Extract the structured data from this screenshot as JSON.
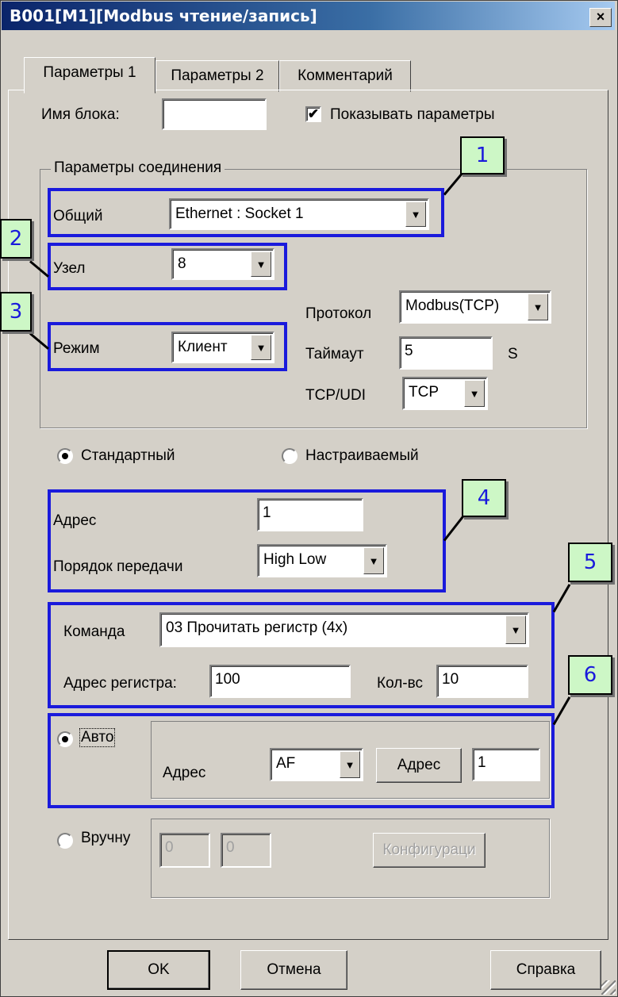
{
  "window": {
    "title": "B001[M1][Modbus чтение/запись]",
    "close_label": "×"
  },
  "tabs": [
    {
      "label": "Параметры 1",
      "active": true
    },
    {
      "label": "Параметры 2",
      "active": false
    },
    {
      "label": "Комментарий",
      "active": false
    }
  ],
  "block": {
    "name_label": "Имя блока:",
    "name_value": "",
    "show_params_label": "Показывать параметры",
    "show_params_checked": true,
    "check_glyph": "✔"
  },
  "connection": {
    "group_label": "Параметры соединения",
    "common_label": "Общий",
    "common_value": "Ethernet : Socket 1",
    "node_label": "Узел",
    "node_value": "8",
    "mode_label": "Режим",
    "mode_value": "Клиент",
    "protocol_label": "Протокол",
    "protocol_value": "Modbus(TCP)",
    "timeout_label": "Таймаут",
    "timeout_value": "5",
    "timeout_unit": "S",
    "tcpudp_label": "TCP/UDI",
    "tcpudp_value": "TCP"
  },
  "mode_radio": {
    "standard_label": "Стандартный",
    "custom_label": "Настраиваемый",
    "selected": "standard"
  },
  "address": {
    "address_label": "Адрес",
    "address_value": "1",
    "order_label": "Порядок передачи",
    "order_value": "High Low"
  },
  "command": {
    "label": "Команда",
    "value": "03 Прочитать регистр (4x)",
    "reg_label": "Адрес регистра:",
    "reg_value": "100",
    "count_label": "Кол-вс",
    "count_value": "10"
  },
  "auto": {
    "radio_label": "Авто",
    "address_label": "Адрес",
    "address_value": "AF",
    "button_label": "Адрес",
    "value": "1"
  },
  "manual": {
    "radio_label": "Вручну",
    "field1": "0",
    "field2": "0",
    "button_label": "Конфигураци"
  },
  "footer": {
    "ok_label": "OK",
    "cancel_label": "Отмена",
    "help_label": "Справка"
  },
  "callouts": [
    "1",
    "2",
    "3",
    "4",
    "5",
    "6"
  ],
  "icons": {
    "dropdown": "▼"
  },
  "colors": {
    "highlight": "#1a1adc",
    "callout_bg": "#cdf7c6",
    "dialog_bg": "#d4d0c8",
    "titlebar": "#0a246a"
  }
}
